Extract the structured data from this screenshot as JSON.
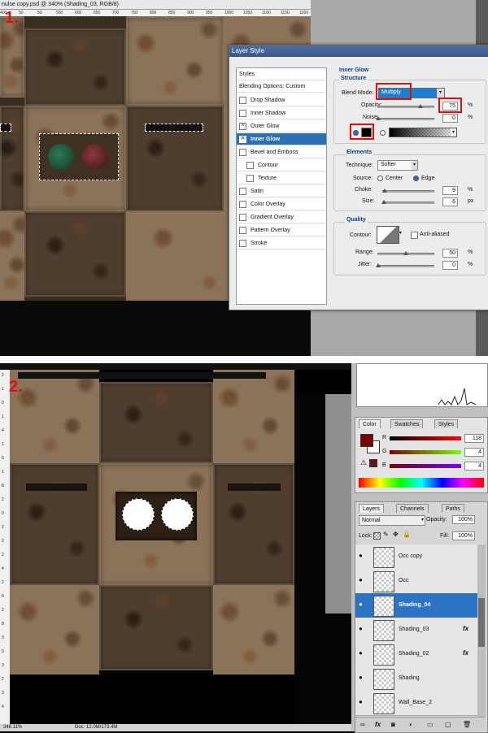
{
  "section1": {
    "step_label": "1.",
    "doc_title": "nulse copy.psd @ 340% (Shading_03, RGB/8)",
    "ruler_ticks": [
      "400",
      "50",
      "50",
      "550",
      "600",
      "650",
      "700",
      "750",
      "800",
      "850",
      "900",
      "950",
      "1000",
      "1050",
      "1100",
      "1150",
      "1200"
    ],
    "dialog": {
      "title": "Layer Style",
      "styles_header": "Styles",
      "blending_options": "Blending Options: Custom",
      "effects": [
        {
          "label": "Drop Shadow",
          "checked": false,
          "selected": false,
          "indent": false
        },
        {
          "label": "Inner Shadow",
          "checked": false,
          "selected": false,
          "indent": false
        },
        {
          "label": "Outer Glow",
          "checked": true,
          "selected": false,
          "indent": false
        },
        {
          "label": "Inner Glow",
          "checked": true,
          "selected": true,
          "indent": false
        },
        {
          "label": "Bevel and Emboss",
          "checked": false,
          "selected": false,
          "indent": false
        },
        {
          "label": "Contour",
          "checked": false,
          "selected": false,
          "indent": true
        },
        {
          "label": "Texture",
          "checked": false,
          "selected": false,
          "indent": true
        },
        {
          "label": "Satin",
          "checked": false,
          "selected": false,
          "indent": false
        },
        {
          "label": "Color Overlay",
          "checked": false,
          "selected": false,
          "indent": false
        },
        {
          "label": "Gradient Overlay",
          "checked": false,
          "selected": false,
          "indent": false
        },
        {
          "label": "Pattern Overlay",
          "checked": false,
          "selected": false,
          "indent": false
        },
        {
          "label": "Stroke",
          "checked": false,
          "selected": false,
          "indent": false
        }
      ],
      "inner_glow_header": "Inner Glow",
      "structure": {
        "header": "Structure",
        "blend_mode_label": "Blend Mode:",
        "blend_mode_value": "Multiply",
        "opacity_label": "Opacity:",
        "opacity_value": "75",
        "opacity_fraction": 0.75,
        "noise_label": "Noise:",
        "noise_value": "0",
        "percent": "%",
        "glow_color": "#000000"
      },
      "elements": {
        "header": "Elements",
        "technique_label": "Technique:",
        "technique_value": "Softer",
        "source_label": "Source:",
        "source_center": "Center",
        "source_edge": "Edge",
        "choke_label": "Choke:",
        "choke_value": "9",
        "size_label": "Size:",
        "size_value": "6",
        "px": "px"
      },
      "quality": {
        "header": "Quality",
        "contour_label": "Contour:",
        "anti_aliased_label": "Anti-aliased",
        "range_label": "Range:",
        "range_value": "50",
        "jitter_label": "Jitter:",
        "jitter_value": "0"
      }
    }
  },
  "section2": {
    "step_label": "2.",
    "status_zoom": "348.11%",
    "status_doc": "Doc: 12.0M/173.4M",
    "color_panel": {
      "tabs": [
        "Color",
        "Swatches",
        "Styles"
      ],
      "r_label": "R",
      "r_value": "118",
      "g_label": "G",
      "g_value": "4",
      "b_label": "B",
      "b_value": "4",
      "foreground": "#760404"
    },
    "layers_panel": {
      "tabs": [
        "Layers",
        "Channels",
        "Paths"
      ],
      "blend_mode": "Normal",
      "opacity_label": "Opacity:",
      "opacity_value": "100%",
      "lock_label": "Lock:",
      "fill_label": "Fill:",
      "fill_value": "100%",
      "layers": [
        {
          "name": "Occ copy",
          "selected": false,
          "fx": false
        },
        {
          "name": "Occ",
          "selected": false,
          "fx": false
        },
        {
          "name": "Shading_04",
          "selected": true,
          "fx": false
        },
        {
          "name": "Shading_03",
          "selected": false,
          "fx": true
        },
        {
          "name": "Shading_02",
          "selected": false,
          "fx": true
        },
        {
          "name": "Shading",
          "selected": false,
          "fx": false
        },
        {
          "name": "Wall_Base_2",
          "selected": false,
          "fx": false
        }
      ],
      "fx_label": "fx"
    }
  },
  "colors": {
    "accent": "#e01010",
    "selection_blue": "#2d73c4",
    "highlight_field": "#1e7fd2"
  }
}
